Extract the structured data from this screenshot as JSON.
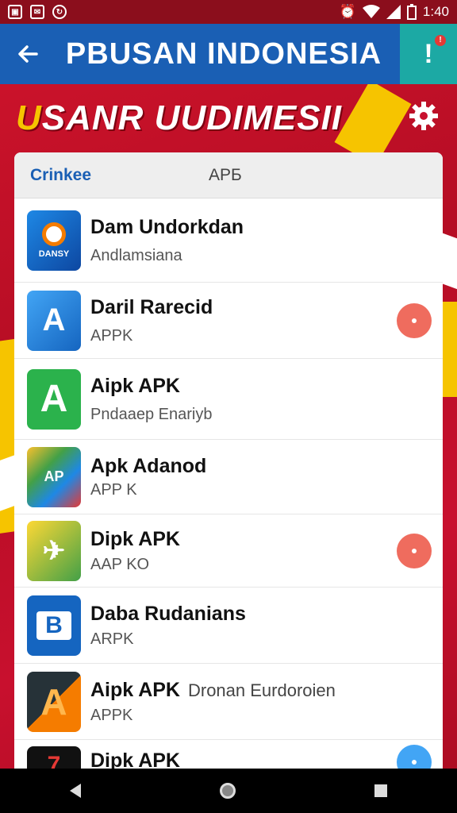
{
  "status_bar": {
    "time": "1:40",
    "left_icons": [
      "image-icon",
      "message-icon",
      "sync-icon"
    ],
    "right_icons": [
      "alarm-icon",
      "wifi-icon",
      "signal-icon",
      "battery-icon"
    ]
  },
  "app_bar": {
    "back_icon": "arrow-back-icon",
    "title": "PBUSAN INDONESIA",
    "action_icon": "alert-icon",
    "action_color": "#1ca9a4",
    "color": "#1a5fb4"
  },
  "banner": {
    "first_letter": "U",
    "text_rest": "SANR UUDIMESII",
    "action_icon": "settings-gear-icon"
  },
  "card": {
    "tabs": [
      "Crinkee",
      "APБ"
    ],
    "apps": [
      {
        "name": "Dam Undorkdan",
        "sub": "Andlamsiana",
        "icon_label": "DANSY",
        "icon_color": "#1976d2",
        "dot": null
      },
      {
        "name": "Daril Rarecid",
        "sub": "APPK",
        "icon_label": "A",
        "icon_color": "#1e88e5",
        "dot": "#ef6c5e"
      },
      {
        "name": "Aipk APK",
        "sub": "Pndaaep Enariyb",
        "icon_label": "A",
        "icon_color": "#2bb24c",
        "dot": null
      },
      {
        "name": "Apk Adanod",
        "sub": "APP K",
        "icon_label": "AP",
        "icon_color": "#ffffff",
        "dot": null
      },
      {
        "name": "Dipk APK",
        "sub": "AAP KO",
        "icon_label": "✈",
        "icon_color": "#8bc34a",
        "dot": "#ef6c5e"
      },
      {
        "name": "Daba Rudanians",
        "sub": "ARPK",
        "icon_label": "B",
        "icon_color": "#1565c0",
        "dot": null
      },
      {
        "name": "Aipk APK",
        "name_extra": "Dronan Eurdoroien",
        "sub": "APPK",
        "icon_label": "A",
        "icon_color": "#263238",
        "dot": null
      },
      {
        "name": "Dipk APK",
        "sub": "",
        "icon_label": "7",
        "icon_color": "#111111",
        "dot": "#42a5f5"
      }
    ]
  },
  "nav_bar": {
    "icons": [
      "nav-back-icon",
      "nav-home-icon",
      "nav-recents-icon"
    ]
  }
}
